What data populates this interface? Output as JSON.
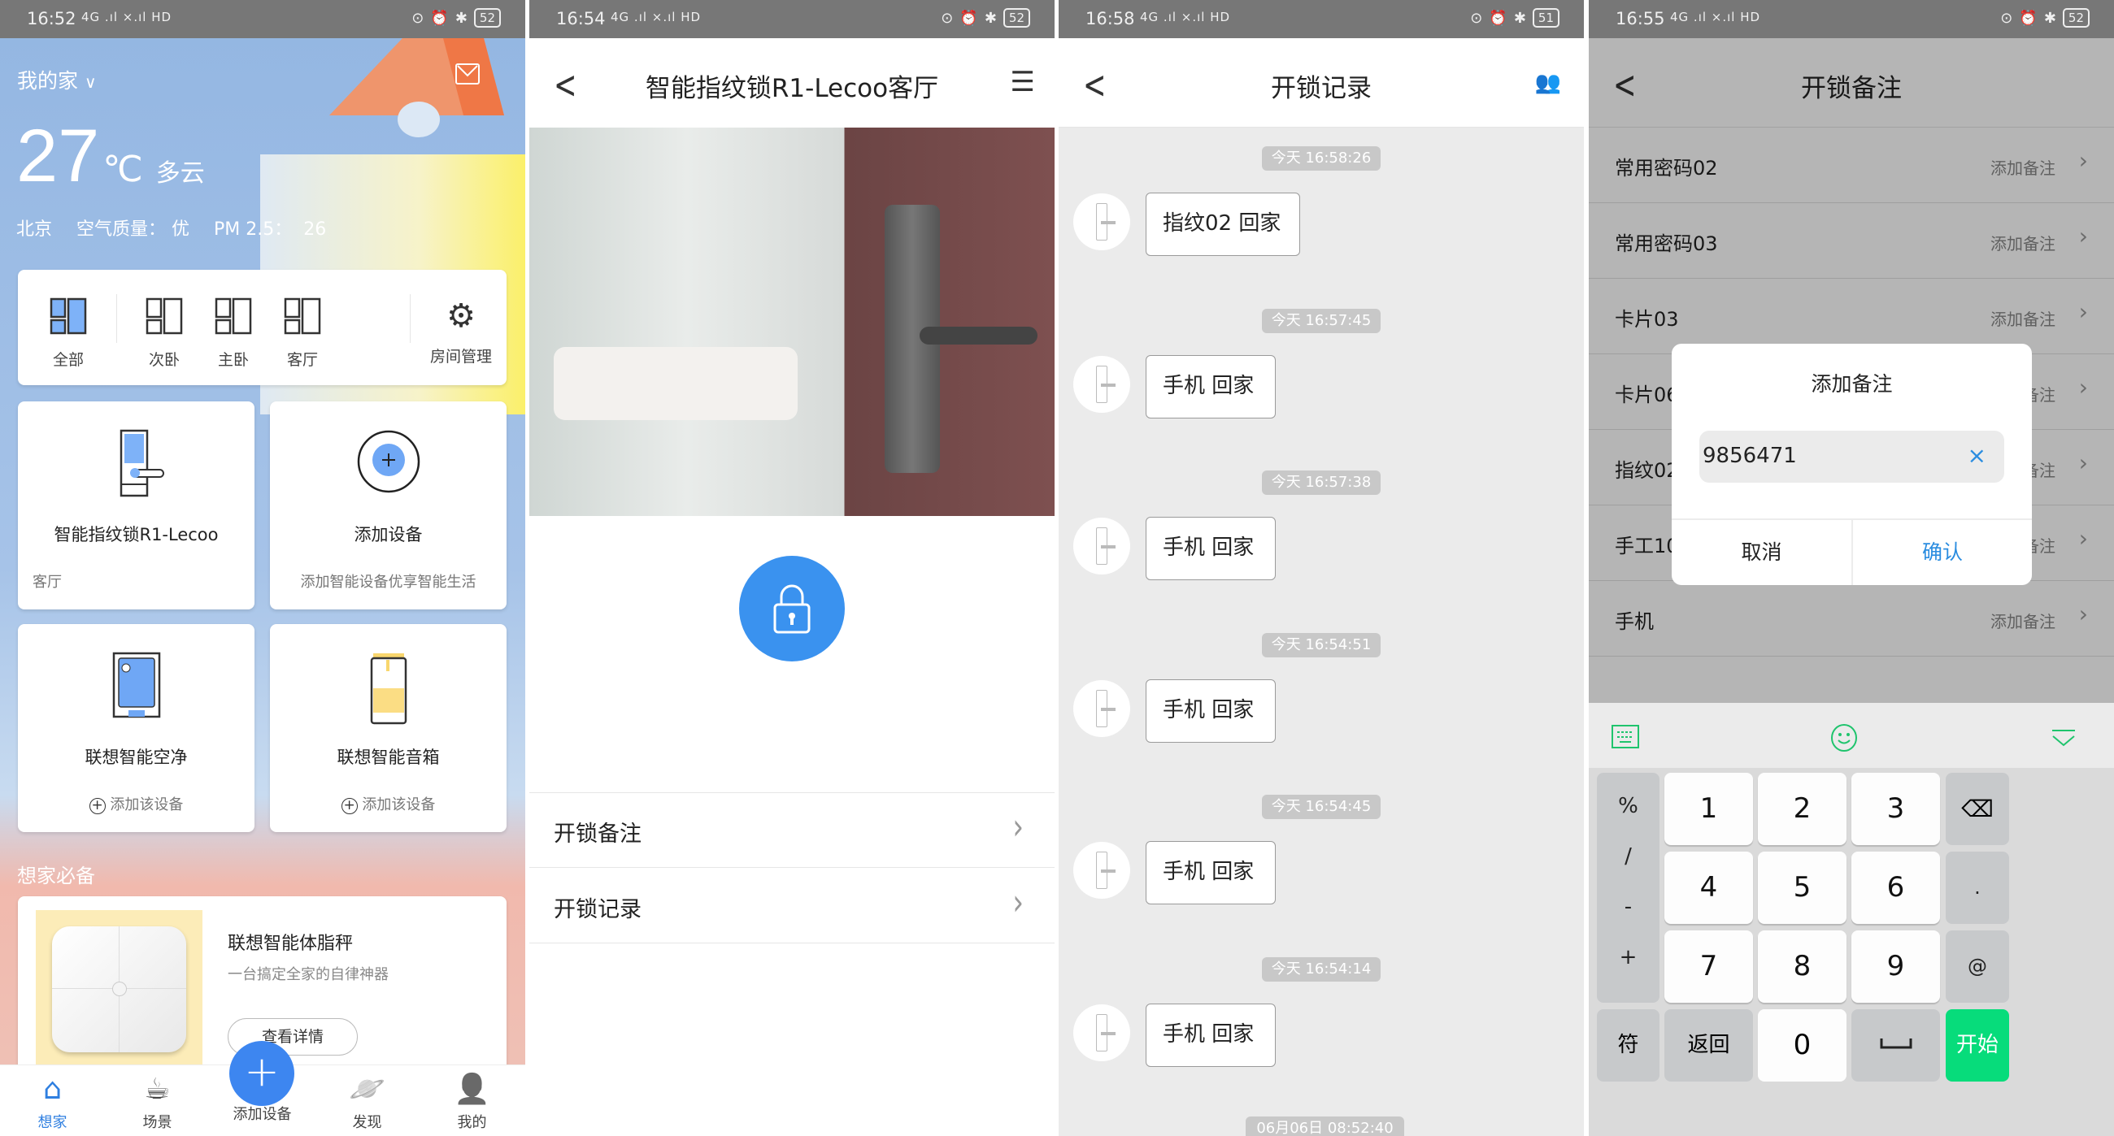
{
  "colors": {
    "accent": "#3d86f0",
    "keyboard_green": "#1fc46d",
    "confirm_blue": "#2b8de0"
  },
  "panels": [
    {
      "status": {
        "time": "16:52",
        "battery": "52"
      }
    },
    {
      "status": {
        "time": "16:54",
        "battery": "52"
      }
    },
    {
      "status": {
        "time": "16:58",
        "battery": "51"
      }
    },
    {
      "status": {
        "time": "16:55",
        "battery": "52"
      }
    }
  ],
  "status_signal": "4G .ıl ×.ıl HD",
  "home": {
    "home_name": "我的家",
    "temperature": "27",
    "unit": "℃",
    "weather": "多云",
    "city": "北京",
    "air_quality": "空气质量： 优",
    "pm25": "PM 2.5：  26",
    "rooms": [
      {
        "label": "全部",
        "active": true
      },
      {
        "label": "次卧"
      },
      {
        "label": "主卧"
      },
      {
        "label": "客厅"
      }
    ],
    "room_manage": "房间管理",
    "devices": [
      {
        "name": "智能指纹锁R1-Lecoo",
        "sub": "客厅",
        "icon": "smart-lock-icon"
      },
      {
        "name": "添加设备",
        "sub": "添加智能设备优享智能生活",
        "icon": "add-device-icon"
      },
      {
        "name": "联想智能空净",
        "sub": "添加该设备",
        "icon": "air-purifier-icon"
      },
      {
        "name": "联想智能音箱",
        "sub": "添加该设备",
        "icon": "smart-speaker-icon"
      }
    ],
    "section_title": "想家必备",
    "promo": {
      "title": "联想智能体脂秤",
      "desc": "一台搞定全家的自律神器",
      "button": "查看详情"
    },
    "nav": [
      {
        "label": "想家",
        "active": true,
        "icon": "home-icon"
      },
      {
        "label": "场景",
        "icon": "cup-icon"
      },
      {
        "label": "添加设备",
        "icon": "plus-icon"
      },
      {
        "label": "发现",
        "icon": "planet-icon"
      },
      {
        "label": "我的",
        "icon": "user-icon"
      }
    ]
  },
  "lock": {
    "title": "智能指纹锁R1-Lecoo客厅",
    "menu": [
      {
        "label": "开锁备注"
      },
      {
        "label": "开锁记录"
      }
    ]
  },
  "records": {
    "title": "开锁记录",
    "items": [
      {
        "time": "今天 16:58:26",
        "text": "指纹02 回家"
      },
      {
        "time": "今天 16:57:45",
        "text": "手机 回家"
      },
      {
        "time": "今天 16:57:38",
        "text": "手机 回家"
      },
      {
        "time": "今天 16:54:51",
        "text": "手机 回家"
      },
      {
        "time": "今天 16:54:45",
        "text": "手机 回家"
      },
      {
        "time": "今天 16:54:14",
        "text": "手机 回家"
      }
    ],
    "last_time": "06月06日 08:52:40"
  },
  "notes": {
    "title": "开锁备注",
    "rows": [
      {
        "name": "常用密码02",
        "action": "添加备注"
      },
      {
        "name": "常用密码03",
        "action": "添加备注"
      },
      {
        "name": "卡片03",
        "action": "添加备注"
      },
      {
        "name": "卡片06",
        "action": "添加备注"
      },
      {
        "name": "指纹02",
        "action": "添加备注"
      },
      {
        "name": "手工10",
        "action": "添加备注"
      },
      {
        "name": "手机",
        "action": "添加备注"
      }
    ],
    "dialog": {
      "title": "添加备注",
      "value": "9856471",
      "cancel": "取消",
      "confirm": "确认"
    },
    "keyboard": {
      "left": [
        "%",
        "/",
        "-",
        "+"
      ],
      "digits": [
        "1",
        "2",
        "3",
        "4",
        "5",
        "6",
        "7",
        "8",
        "9"
      ],
      "right": [
        ".",
        "@"
      ],
      "bottom": {
        "symbols": "符",
        "back": "返回",
        "zero": "0",
        "go": "开始"
      }
    }
  }
}
